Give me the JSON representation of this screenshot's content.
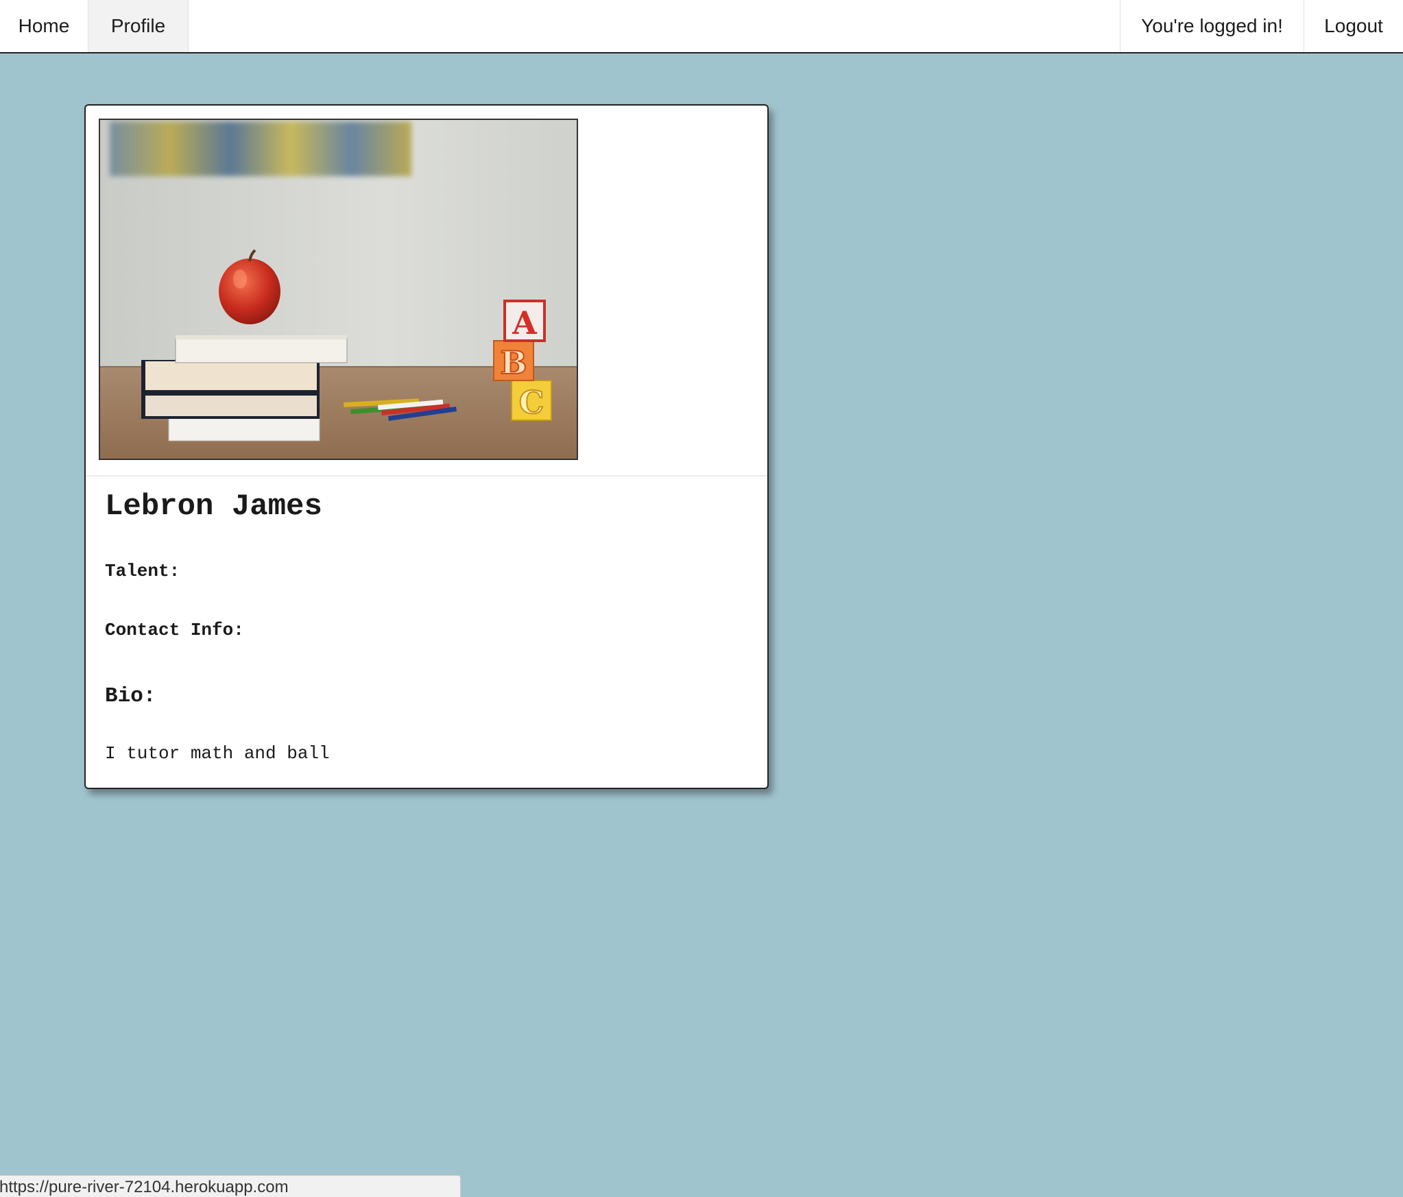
{
  "nav": {
    "home_label": "Home",
    "profile_label": "Profile",
    "status_label": "You're logged in!",
    "logout_label": "Logout"
  },
  "profile": {
    "name": "Lebron James",
    "talent_label": "Talent:",
    "contact_label": "Contact Info:",
    "bio_label": "Bio:",
    "bio_text": "I tutor math and ball",
    "image_subject": "apple-on-books-with-abc-blocks-photo"
  },
  "status_bar": {
    "url": "https://pure-river-72104.herokuapp.com"
  },
  "colors": {
    "background": "#a0c4ce",
    "card": "#ffffff",
    "nav_active": "#f2f2f2"
  }
}
